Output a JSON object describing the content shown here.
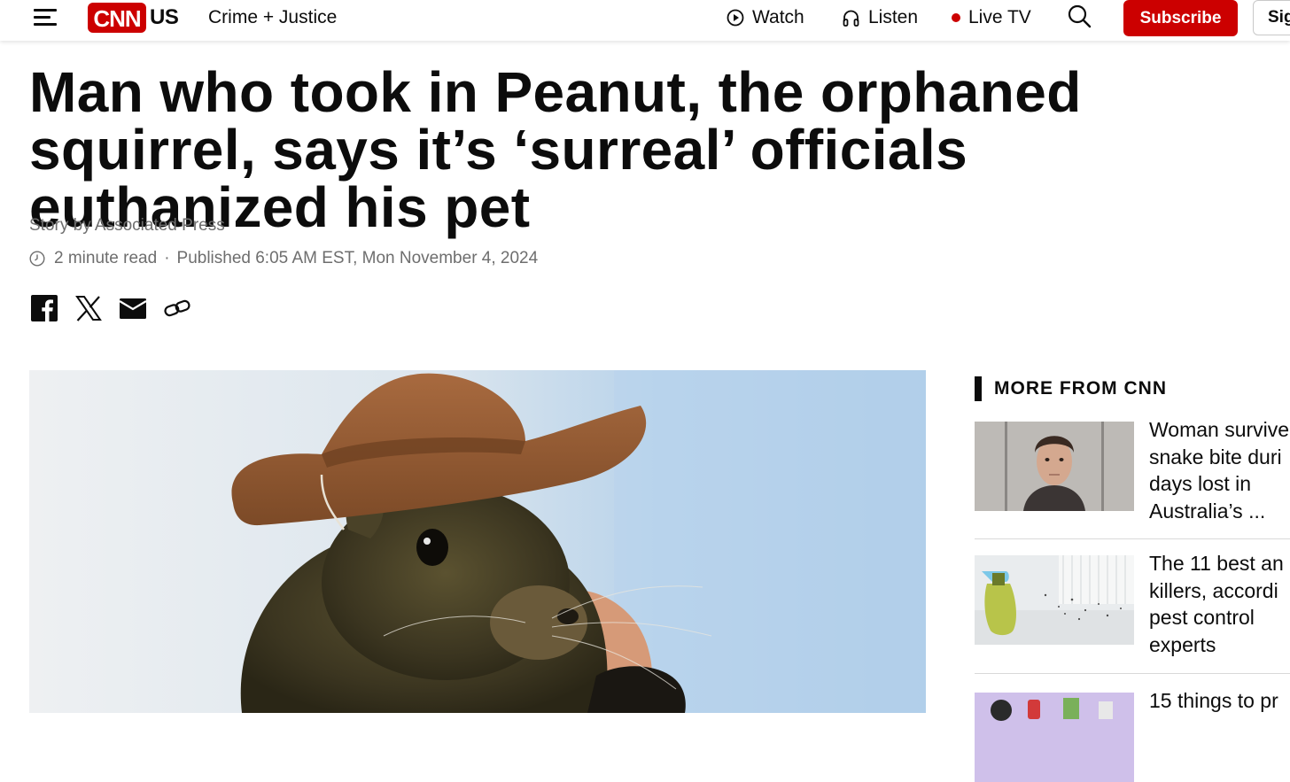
{
  "header": {
    "logo_text": "CNN",
    "edition": "US",
    "section": "Crime + Justice",
    "nav": {
      "watch": "Watch",
      "listen": "Listen",
      "live_tv": "Live TV"
    },
    "subscribe": "Subscribe",
    "sign_in": "Sign in"
  },
  "article": {
    "headline": "Man who took in Peanut, the orphaned squirrel, says it’s ‘surreal’ officials euthanized his pet",
    "byline": "Story by Associated Press",
    "read_time": "2 minute read",
    "separator": "·",
    "published": "Published 6:05 AM EST, Mon November 4, 2024",
    "share": [
      "facebook-icon",
      "x-icon",
      "email-icon",
      "link-icon"
    ]
  },
  "sidebar": {
    "title": "MORE FROM CNN",
    "cards": [
      {
        "lines": [
          "Woman survive",
          "snake bite duri",
          "days lost in",
          "Australia’s ..."
        ]
      },
      {
        "lines": [
          "The 11 best an",
          "killers, accordi",
          "pest control",
          "experts"
        ]
      },
      {
        "lines": [
          "15 things to pr"
        ]
      }
    ]
  },
  "colors": {
    "brand_red": "#cc0000",
    "text": "#0c0c0c",
    "meta_text": "#6e6e6e"
  }
}
